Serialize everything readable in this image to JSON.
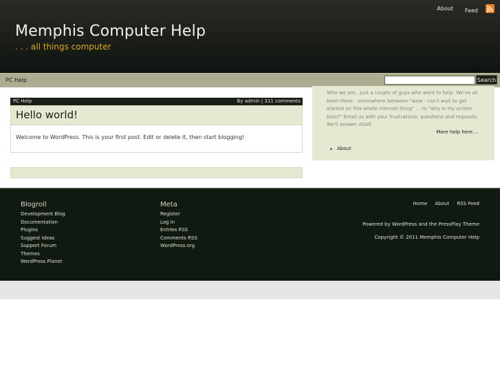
{
  "header": {
    "title": "Memphis Computer Help",
    "tagline": ". . . all things computer",
    "top_links": {
      "about": "About",
      "feed": "Feed"
    }
  },
  "nav": {
    "items": [
      "PC Help"
    ],
    "search_placeholder": "",
    "search_button": "Search"
  },
  "post": {
    "category": "PC Help",
    "meta": "By admin | 311 comments",
    "title": "Hello world!",
    "body": "Welcome to WordPress. This is your first post. Edit or delete it, then start blogging!"
  },
  "sidebar": {
    "text": "Who we are.. Just a couple of guys who want to help. We've all been there - somewhere between \"wow - can't wait to get started on this whole internet thing\" ... to \"why is my screen blue?\" Email us with your frustrations, questions and requests. We'll answer ASAP.",
    "more_link": "More help here....",
    "pages": [
      "About"
    ]
  },
  "footer": {
    "blogroll": {
      "title": "Blogroll",
      "links": [
        "Development Blog",
        "Documentation",
        "Plugins",
        "Suggest Ideas",
        "Support Forum",
        "Themes",
        "WordPress Planet"
      ]
    },
    "meta": {
      "title": "Meta",
      "links": [
        "Register",
        "Log in",
        "Entries RSS",
        "Comments RSS",
        "WordPress.org"
      ]
    },
    "nav": [
      "Home",
      "About",
      "RSS Feed"
    ],
    "powered": "Powered by WordPress and the PressPlay Theme",
    "copyright": "Copyright © 2011 Memphis Computer Help"
  },
  "colors": {
    "header_bg": "#1d201b",
    "tagline": "#e0a82a",
    "nav_bg": "#acac90",
    "panel_bg": "#e6e9d2",
    "footer_bg": "#111a10",
    "rss": "#f07a19"
  },
  "icons": {
    "rss": "rss-feed-icon",
    "bullet": "bullet-icon"
  }
}
